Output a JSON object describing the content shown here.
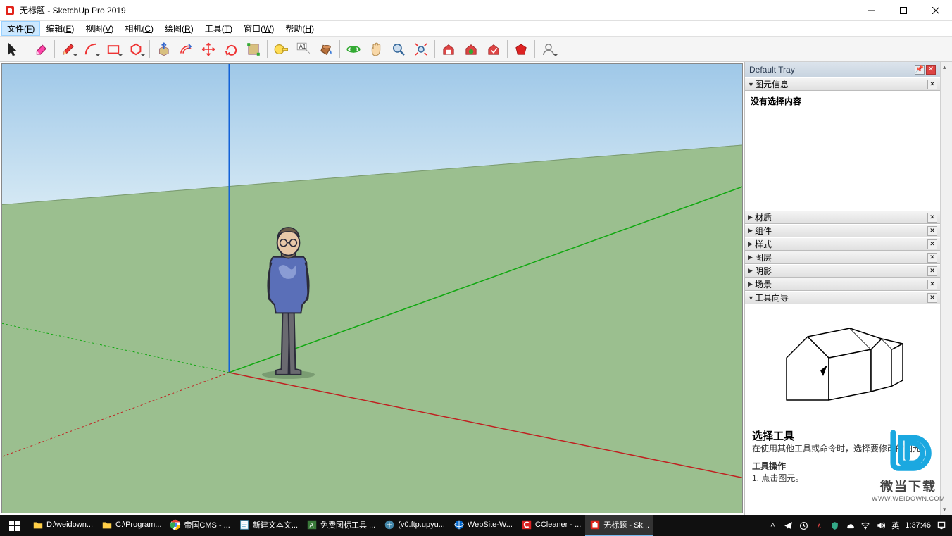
{
  "window": {
    "title": "无标题 - SketchUp Pro 2019"
  },
  "menu": [
    {
      "label": "文件",
      "key": "F",
      "selected": true
    },
    {
      "label": "编辑",
      "key": "E"
    },
    {
      "label": "视图",
      "key": "V"
    },
    {
      "label": "相机",
      "key": "C"
    },
    {
      "label": "绘图",
      "key": "R"
    },
    {
      "label": "工具",
      "key": "T"
    },
    {
      "label": "窗口",
      "key": "W"
    },
    {
      "label": "帮助",
      "key": "H"
    }
  ],
  "toolbar_groups": [
    {
      "tools": [
        {
          "name": "select-tool",
          "icon": "cursor"
        }
      ]
    },
    {
      "tools": [
        {
          "name": "eraser-tool",
          "icon": "eraser"
        }
      ]
    },
    {
      "tools": [
        {
          "name": "line-tool",
          "icon": "pencil",
          "dd": true
        },
        {
          "name": "arc-tool",
          "icon": "arc",
          "dd": true
        },
        {
          "name": "rectangle-tool",
          "icon": "rect",
          "dd": true
        },
        {
          "name": "circle-tool",
          "icon": "circle",
          "dd": true
        }
      ]
    },
    {
      "tools": [
        {
          "name": "pushpull-tool",
          "icon": "pushpull"
        },
        {
          "name": "offset-tool",
          "icon": "offset"
        },
        {
          "name": "move-tool",
          "icon": "move"
        },
        {
          "name": "rotate-tool",
          "icon": "rotate"
        },
        {
          "name": "scale-tool",
          "icon": "scale"
        }
      ]
    },
    {
      "tools": [
        {
          "name": "tape-tool",
          "icon": "tape"
        },
        {
          "name": "text-tool",
          "icon": "text"
        },
        {
          "name": "paint-tool",
          "icon": "bucket"
        }
      ]
    },
    {
      "tools": [
        {
          "name": "orbit-tool",
          "icon": "orbit"
        },
        {
          "name": "pan-tool",
          "icon": "pan"
        },
        {
          "name": "zoom-tool",
          "icon": "zoom"
        },
        {
          "name": "zoom-extents-tool",
          "icon": "zoomext"
        }
      ]
    },
    {
      "tools": [
        {
          "name": "warehouse-tool",
          "icon": "wh1"
        },
        {
          "name": "ext-warehouse-tool",
          "icon": "wh2"
        },
        {
          "name": "ext-manager-tool",
          "icon": "wh3"
        }
      ]
    },
    {
      "tools": [
        {
          "name": "ruby-tool",
          "icon": "ruby"
        }
      ]
    },
    {
      "tools": [
        {
          "name": "user-tool",
          "icon": "user",
          "dd": true
        }
      ]
    }
  ],
  "tray": {
    "header": "Default Tray",
    "panels": [
      {
        "title": "图元信息",
        "expanded": true,
        "body": "没有选择内容"
      },
      {
        "title": "材质",
        "expanded": false
      },
      {
        "title": "组件",
        "expanded": false
      },
      {
        "title": "样式",
        "expanded": false
      },
      {
        "title": "图层",
        "expanded": false
      },
      {
        "title": "阴影",
        "expanded": false
      },
      {
        "title": "场景",
        "expanded": false
      },
      {
        "title": "工具向导",
        "expanded": true
      }
    ],
    "instructor": {
      "title": "选择工具",
      "desc": "在使用其他工具或命令时，选择要修改的图元。",
      "sub_title": "工具操作",
      "step1": "1. 点击图元。"
    }
  },
  "watermark": {
    "line1": "微当下载",
    "line2": "WWW.WEIDOWN.COM"
  },
  "taskbar": {
    "items": [
      {
        "label": "D:\\weidown...",
        "icon": "folder"
      },
      {
        "label": "C:\\Program...",
        "icon": "folder"
      },
      {
        "label": "帝国CMS - ...",
        "icon": "chrome"
      },
      {
        "label": "新建文本文...",
        "icon": "notepad"
      },
      {
        "label": "免费图标工具 ...",
        "icon": "app1"
      },
      {
        "label": "(v0.ftp.upyu...",
        "icon": "ftp"
      },
      {
        "label": "WebSite-W...",
        "icon": "ws"
      },
      {
        "label": "CCleaner - ...",
        "icon": "cc"
      },
      {
        "label": "无标题 - Sk...",
        "icon": "su",
        "active": true
      }
    ],
    "ime": "英",
    "time": "1:37:46"
  }
}
